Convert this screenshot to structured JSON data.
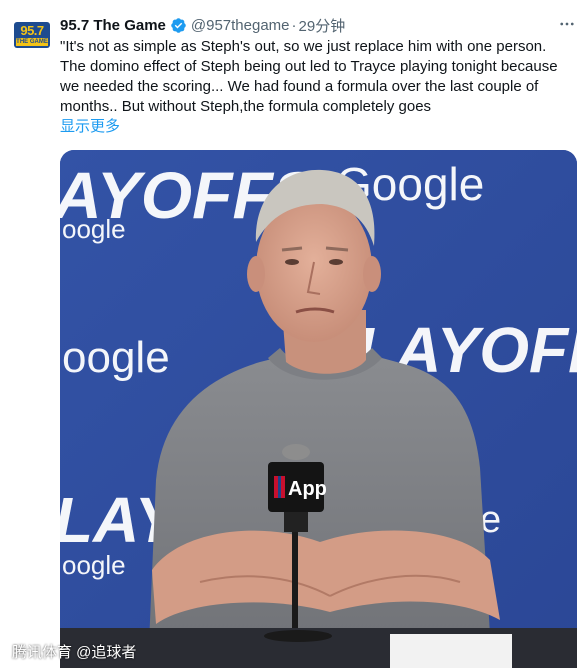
{
  "author": {
    "avatar_logo_number": "95.7",
    "avatar_logo_sub": "THE GAME",
    "display_name": "95.7 The Game",
    "handle": "@957thegame",
    "separator": "·",
    "time": "29分钟",
    "verified": true
  },
  "tweet": {
    "text": "\"It's not as simple as Steph's out, so we just replace him with one person.\nThe domino effect of Steph being out led to Trayce playing tonight because\nwe needed the scoring... We had found a formula over the last couple of\nmonths.. But without Steph,the formula completely goes",
    "show_more_label": "显示更多"
  },
  "media": {
    "backdrop_words": {
      "playoffs_top": "AYOFFS",
      "google_top_right": "Google",
      "google_left_1": "oogle",
      "google_left_2": "oogle",
      "playoffs_right": "LAYOFFS",
      "playoffs_bottom_left": "LAYOF",
      "google_bottom_left": "oogle",
      "partial_right": "e"
    },
    "mic_label": "App",
    "description": "press-conference-photo"
  },
  "watermark": "腾讯体育 @追球者",
  "colors": {
    "link": "#1d9bf0",
    "secondary_text": "#536471",
    "verified": "#1d9bf0",
    "backdrop": "#2f4ea0"
  },
  "icons": {
    "verified": "verified-badge-icon",
    "more": "more-options-icon"
  }
}
